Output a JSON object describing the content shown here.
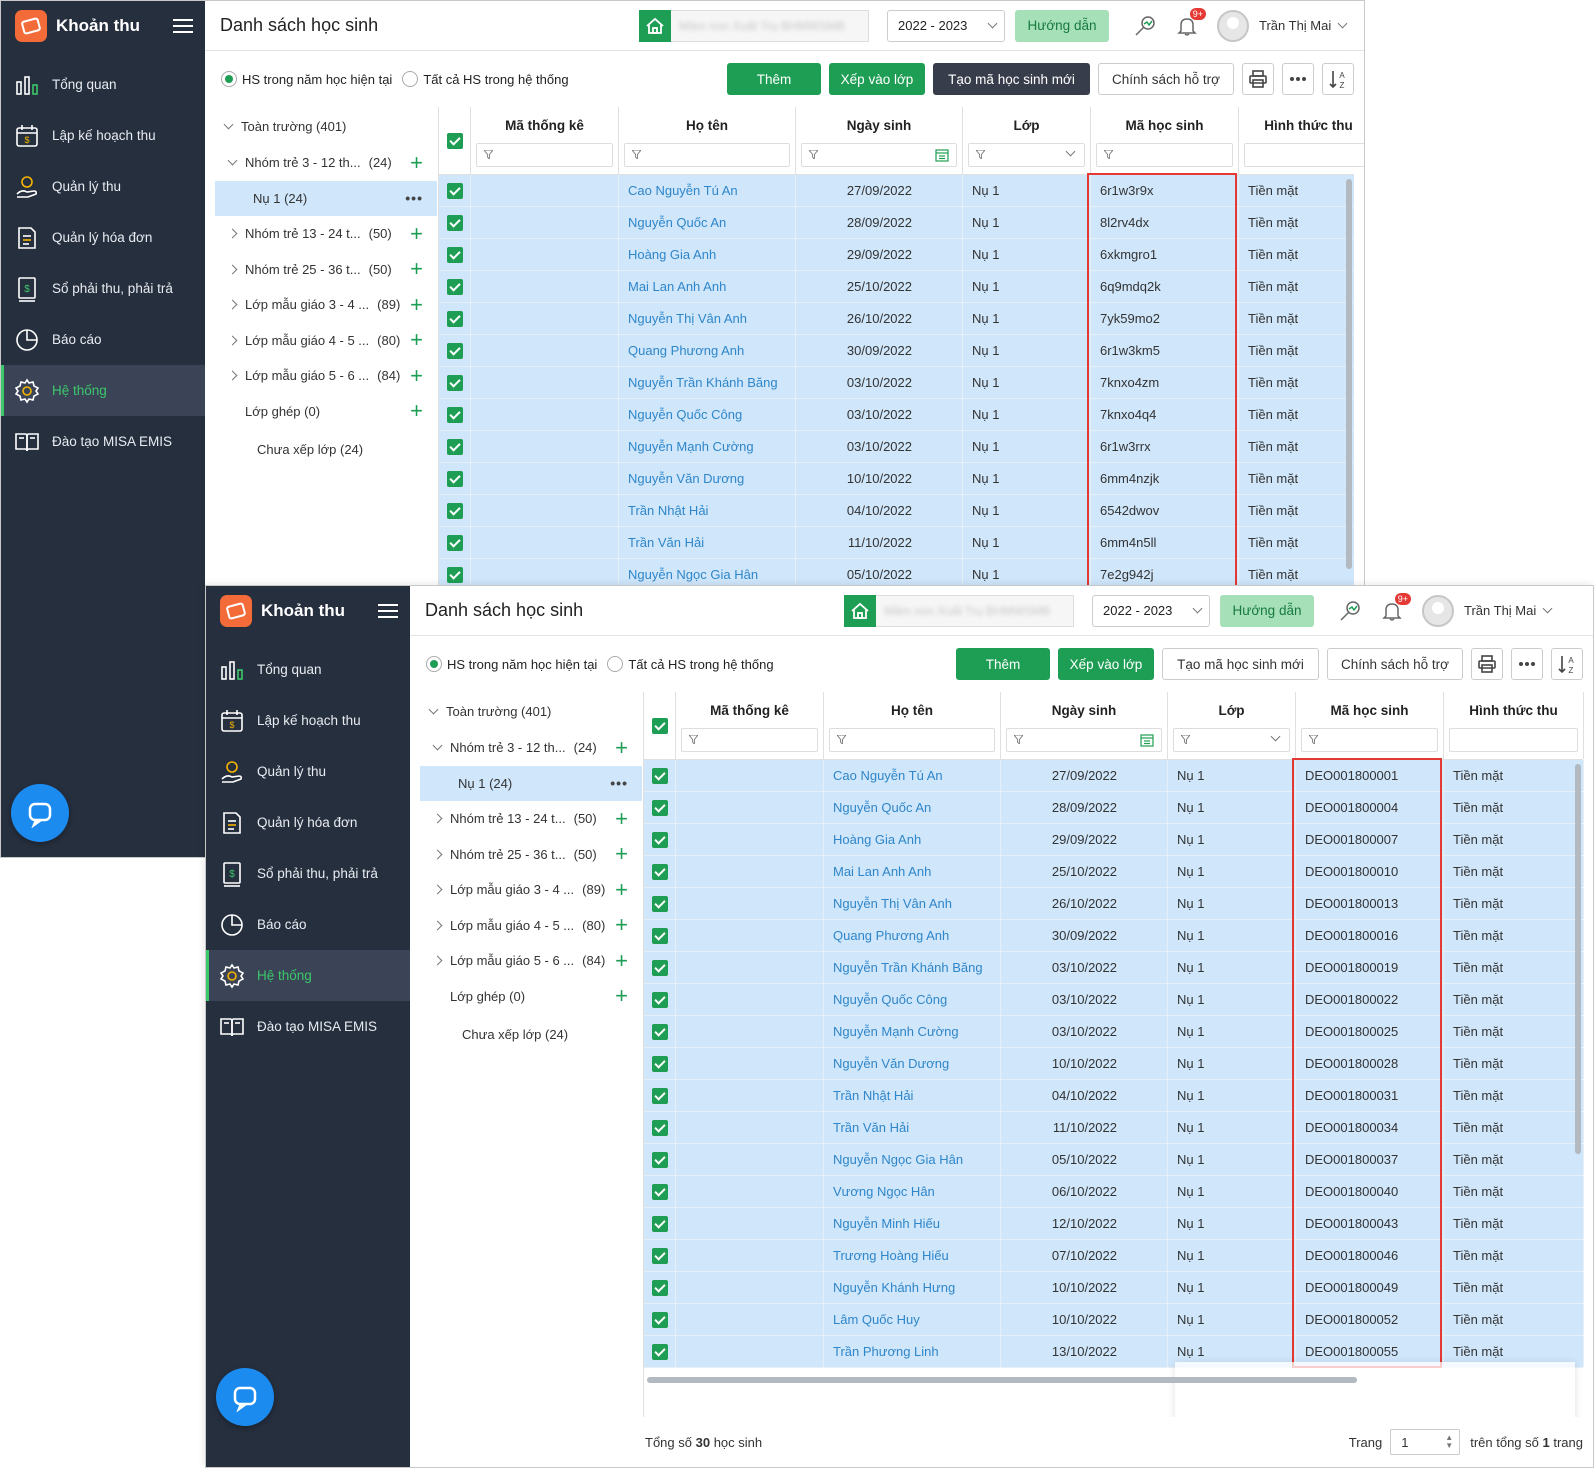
{
  "sidebar": {
    "brand": "Khoản thu",
    "items": [
      {
        "label": "Tổng quan",
        "icon": "bar-chart-icon"
      },
      {
        "label": "Lập kế hoạch thu",
        "icon": "calendar-money-icon"
      },
      {
        "label": "Quản lý thu",
        "icon": "hand-coin-icon"
      },
      {
        "label": "Quản lý hóa đơn",
        "icon": "invoice-icon"
      },
      {
        "label": "Sổ phải thu, phải trả",
        "icon": "ledger-icon"
      },
      {
        "label": "Báo cáo",
        "icon": "pie-chart-icon"
      },
      {
        "label": "Hệ thống",
        "icon": "gear-icon",
        "active": true
      },
      {
        "label": "Đào tạo MISA EMIS",
        "icon": "book-icon"
      }
    ]
  },
  "header": {
    "title": "Danh sách học sinh",
    "school_name": "Mầm non Xuất Trụ BHMWSMB",
    "school_year": "2022 - 2023",
    "guide_label": "Hướng dẫn",
    "notification_badge": "9+",
    "user_name": "Trần Thị Mai"
  },
  "toolbar": {
    "radio_current": "HS trong năm học hiện tại",
    "radio_all": "Tất cả HS trong hệ thống",
    "add_label": "Thêm",
    "assign_class_label": "Xếp vào lớp",
    "new_code_label": "Tạo mã học sinh mới",
    "policy_label": "Chính sách hỗ trợ"
  },
  "tree": {
    "root": "Toàn trường (401)",
    "items": [
      {
        "label": "Nhóm trẻ 3 - 12 th...",
        "count": "(24)",
        "expanded": true,
        "plus": true
      },
      {
        "label": "Nụ 1 (24)",
        "child": true,
        "selected": true
      },
      {
        "label": "Nhóm trẻ 13 - 24 t...",
        "count": "(50)",
        "plus": true
      },
      {
        "label": "Nhóm trẻ 25 - 36 t...",
        "count": "(50)",
        "plus": true
      },
      {
        "label": "Lớp mẫu giáo 3 - 4 ...",
        "count": "(89)",
        "plus": true
      },
      {
        "label": "Lớp mẫu giáo 4 - 5 ...",
        "count": "(80)",
        "plus": true
      },
      {
        "label": "Lớp mẫu giáo 5 - 6 ...",
        "count": "(84)",
        "plus": true
      },
      {
        "label": "Lớp ghép (0)",
        "plus": true,
        "nocaret": true
      },
      {
        "label": "Chưa xếp lớp (24)",
        "nocaret": true,
        "indent": true
      }
    ]
  },
  "grid": {
    "columns": [
      "Mã thống kê",
      "Họ tên",
      "Ngày sinh",
      "Lớp",
      "Mã học sinh",
      "Hình thức thu"
    ],
    "rows": [
      {
        "name": "Cao Nguyễn Tú An",
        "dob": "27/09/2022",
        "class": "Nụ 1",
        "code_old": "6r1w3r9x",
        "code_new": "DEO001800001",
        "pay": "Tiền mặt"
      },
      {
        "name": "Nguyễn Quốc An",
        "dob": "28/09/2022",
        "class": "Nụ 1",
        "code_old": "8l2rv4dx",
        "code_new": "DEO001800004",
        "pay": "Tiền mặt"
      },
      {
        "name": "Hoàng Gia Anh",
        "dob": "29/09/2022",
        "class": "Nụ 1",
        "code_old": "6xkmgro1",
        "code_new": "DEO001800007",
        "pay": "Tiền mặt"
      },
      {
        "name": "Mai Lan Anh Anh",
        "dob": "25/10/2022",
        "class": "Nụ 1",
        "code_old": "6q9mdq2k",
        "code_new": "DEO001800010",
        "pay": "Tiền mặt"
      },
      {
        "name": "Nguyễn Thị Vân Anh",
        "dob": "26/10/2022",
        "class": "Nụ 1",
        "code_old": "7yk59mo2",
        "code_new": "DEO001800013",
        "pay": "Tiền mặt"
      },
      {
        "name": "Quang Phương Anh",
        "dob": "30/09/2022",
        "class": "Nụ 1",
        "code_old": "6r1w3km5",
        "code_new": "DEO001800016",
        "pay": "Tiền mặt"
      },
      {
        "name": "Nguyễn Trần Khánh Băng",
        "dob": "03/10/2022",
        "class": "Nụ 1",
        "code_old": "7knxo4zm",
        "code_new": "DEO001800019",
        "pay": "Tiền mặt"
      },
      {
        "name": "Nguyễn Quốc Công",
        "dob": "03/10/2022",
        "class": "Nụ 1",
        "code_old": "7knxo4q4",
        "code_new": "DEO001800022",
        "pay": "Tiền mặt"
      },
      {
        "name": "Nguyễn Mạnh Cường",
        "dob": "03/10/2022",
        "class": "Nụ 1",
        "code_old": "6r1w3rrx",
        "code_new": "DEO001800025",
        "pay": "Tiền mặt"
      },
      {
        "name": "Nguyễn Văn Dương",
        "dob": "10/10/2022",
        "class": "Nụ 1",
        "code_old": "6mm4nzjk",
        "code_new": "DEO001800028",
        "pay": "Tiền mặt"
      },
      {
        "name": "Trần Nhật Hải",
        "dob": "04/10/2022",
        "class": "Nụ 1",
        "code_old": "6542dwov",
        "code_new": "DEO001800031",
        "pay": "Tiền mặt"
      },
      {
        "name": "Trần Văn Hải",
        "dob": "11/10/2022",
        "class": "Nụ 1",
        "code_old": "6mm4n5ll",
        "code_new": "DEO001800034",
        "pay": "Tiền mặt"
      },
      {
        "name": "Nguyễn Ngọc Gia Hân",
        "dob": "05/10/2022",
        "class": "Nụ 1",
        "code_old": "7e2g942j",
        "code_new": "DEO001800037",
        "pay": "Tiền mặt"
      },
      {
        "name": "Vương Ngọc Hân",
        "dob": "06/10/2022",
        "class": "Nụ 1",
        "code_new": "DEO001800040",
        "pay": "Tiền mặt"
      },
      {
        "name": "Nguyễn Minh Hiếu",
        "dob": "12/10/2022",
        "class": "Nụ 1",
        "code_new": "DEO001800043",
        "pay": "Tiền mặt"
      },
      {
        "name": "Trương Hoàng Hiếu",
        "dob": "07/10/2022",
        "class": "Nụ 1",
        "code_new": "DEO001800046",
        "pay": "Tiền mặt"
      },
      {
        "name": "Nguyễn Khánh Hưng",
        "dob": "10/10/2022",
        "class": "Nụ 1",
        "code_new": "DEO001800049",
        "pay": "Tiền mặt"
      },
      {
        "name": "Lâm Quốc Huy",
        "dob": "10/10/2022",
        "class": "Nụ 1",
        "code_new": "DEO001800052",
        "pay": "Tiền mặt"
      },
      {
        "name": "Trần Phương Linh",
        "dob": "13/10/2022",
        "class": "Nụ 1",
        "code_new": "DEO001800055",
        "pay": "Tiền mặt"
      }
    ]
  },
  "footer": {
    "total_prefix": "Tổng số",
    "total_count": "30",
    "total_suffix": "học sinh",
    "page_label": "Trang",
    "page_value": "1",
    "of_prefix": "trên tổng số",
    "of_count": "1",
    "of_suffix": "trang"
  },
  "colors": {
    "accent": "#1e9e54",
    "sidebar": "#262f3e",
    "row_selected": "#cfe6fb",
    "link": "#2f86c9",
    "highlight": "#e53935"
  }
}
